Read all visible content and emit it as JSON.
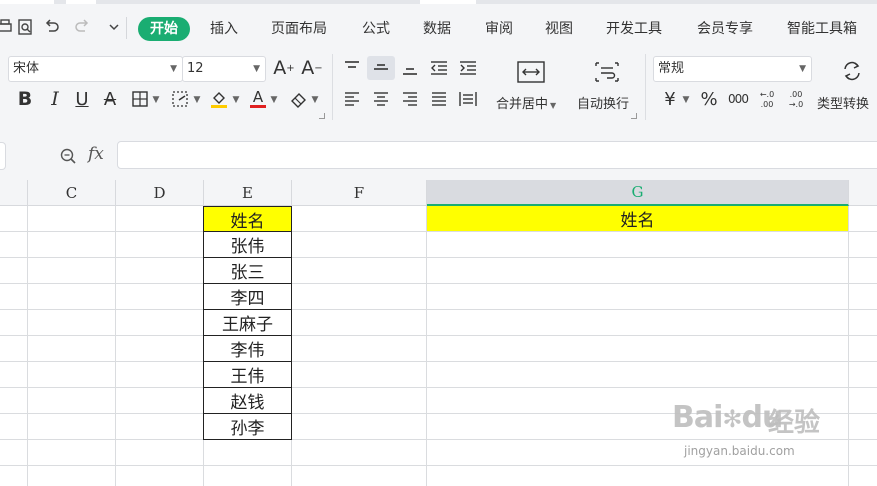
{
  "menubar": {
    "tabs": [
      "开始",
      "插入",
      "页面布局",
      "公式",
      "数据",
      "审阅",
      "视图",
      "开发工具",
      "会员专享",
      "智能工具箱"
    ],
    "active_tab": "开始",
    "active_color": "#1aad72"
  },
  "ribbon": {
    "font_name": "宋体",
    "font_size": "12",
    "merge_label": "合并居中",
    "wrap_label": "自动换行",
    "number_format": "常规",
    "convert_label": "类型转换",
    "fill_color": "#ffcc00",
    "font_color": "#e02020"
  },
  "formula_bar": {
    "fx": "fx",
    "content": ""
  },
  "grid": {
    "columns": [
      "C",
      "D",
      "E",
      "F",
      "G"
    ],
    "selected_column": "G",
    "highlight_color": "#ffff00",
    "e_column": [
      "姓名",
      "张伟",
      "张三",
      "李四",
      "王麻子",
      "李伟",
      "王伟",
      "赵钱",
      "孙李"
    ],
    "g_header": "姓名"
  },
  "watermark": {
    "brand": "Bai",
    "brand_suffix": "du",
    "text": "经验",
    "url": "jingyan.baidu.com"
  }
}
